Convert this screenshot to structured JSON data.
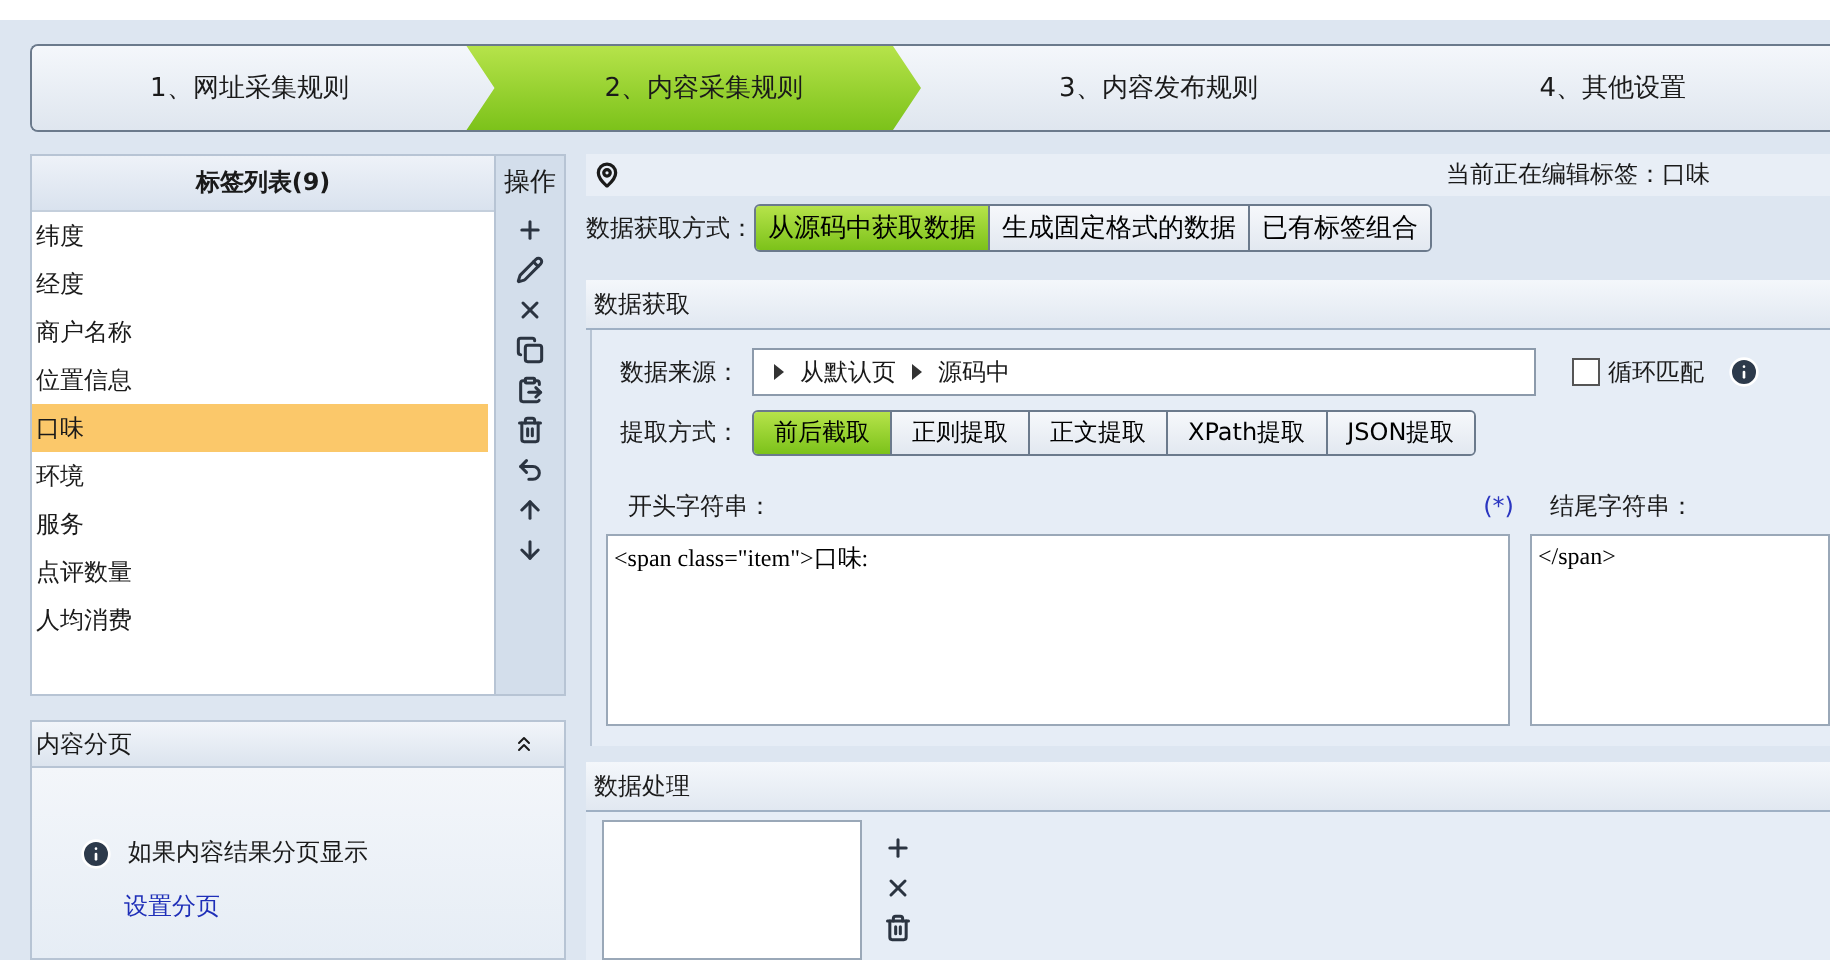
{
  "steps": [
    {
      "label": "1、网址采集规则",
      "selected": false
    },
    {
      "label": "2、内容采集规则",
      "selected": true
    },
    {
      "label": "3、内容发布规则",
      "selected": false
    },
    {
      "label": "4、其他设置",
      "selected": false
    }
  ],
  "tag_list": {
    "title": "标签列表(9)",
    "operations_title": "操作",
    "items": [
      {
        "label": "纬度",
        "selected": false
      },
      {
        "label": "经度",
        "selected": false
      },
      {
        "label": "商户名称",
        "selected": false
      },
      {
        "label": "位置信息",
        "selected": false
      },
      {
        "label": "口味",
        "selected": true
      },
      {
        "label": "环境",
        "selected": false
      },
      {
        "label": "服务",
        "selected": false
      },
      {
        "label": "点评数量",
        "selected": false
      },
      {
        "label": "人均消费",
        "selected": false
      }
    ]
  },
  "pagination": {
    "title": "内容分页",
    "expanded": true,
    "hint": "如果内容结果分页显示",
    "link": "设置分页"
  },
  "editor": {
    "current_tag": "当前正在编辑标签：口味",
    "mode_label": "数据获取方式：",
    "modes": [
      {
        "label": "从源码中获取数据",
        "selected": true
      },
      {
        "label": "生成固定格式的数据",
        "selected": false
      },
      {
        "label": "已有标签组合",
        "selected": false
      }
    ],
    "acquire": {
      "title": "数据获取",
      "source_label": "数据来源：",
      "source_path": [
        "从默认页",
        "源码中"
      ],
      "loop_match": {
        "label": "循环匹配",
        "checked": false
      },
      "extract_label": "提取方式：",
      "methods": [
        {
          "label": "前后截取",
          "selected": true
        },
        {
          "label": "正则提取",
          "selected": false
        },
        {
          "label": "正文提取",
          "selected": false
        },
        {
          "label": "XPath提取",
          "selected": false
        },
        {
          "label": "JSON提取",
          "selected": false
        }
      ],
      "start_label": "开头字符串：",
      "wildcard": "(*)",
      "start_value": "<span class=\"item\">口味:",
      "end_label": "结尾字符串：",
      "end_value": "</span>"
    },
    "processing": {
      "title": "数据处理"
    }
  }
}
